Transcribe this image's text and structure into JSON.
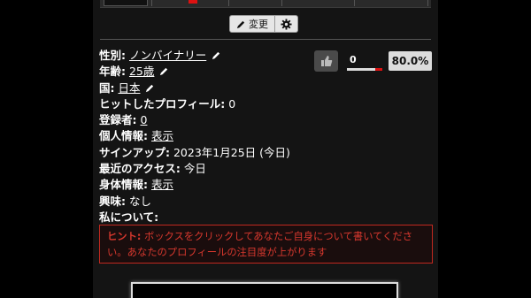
{
  "toolbar": {
    "edit_label": "変更"
  },
  "profile": {
    "gender": {
      "label": "性別:",
      "value": "ノンバイナリー"
    },
    "age": {
      "label": "年齢:",
      "value": "25歳"
    },
    "country": {
      "label": "国:",
      "value": "日本"
    },
    "hits": {
      "label": "ヒットしたプロフィール:",
      "value": "0"
    },
    "subscribers": {
      "label": "登録者:",
      "value": "0"
    },
    "personal": {
      "label": "個人情報:",
      "value": "表示"
    },
    "signup": {
      "label": "サインアップ:",
      "value": "2023年1月25日 (今日)"
    },
    "last_access": {
      "label": "最近のアクセス:",
      "value": "今日"
    },
    "body": {
      "label": "身体情報:",
      "value": "表示"
    },
    "interests": {
      "label": "興味:",
      "value": "なし"
    },
    "about": {
      "label": "私について:"
    }
  },
  "rating": {
    "count": "0",
    "percent": "80.0%",
    "bar_fill": 0.2
  },
  "hint": {
    "prefix": "ヒント:",
    "text": "ボックスをクリックしてあなたご自身について書いてください。あなたのプロフィールの注目度が上がります"
  },
  "colors": {
    "accent_red": "#d8382e",
    "panel_bg": "#141414"
  }
}
